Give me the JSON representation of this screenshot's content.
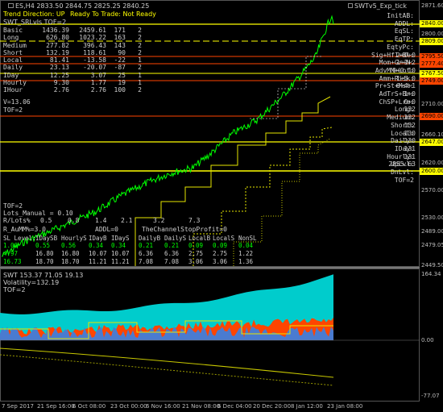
{
  "header": {
    "symbol_line": "ES,H4  2833.50 2844.75 2825.25 2840.25",
    "indicator_name": "SWTv5_Exp_tick"
  },
  "status": {
    "trend": "Trend Direction:  UP",
    "ready": "Ready To Trade:  Not Ready",
    "indicator": "SWT_SRLvls TOF=2"
  },
  "stats_table": [
    [
      "Basic",
      "1436.39",
      "2459.61",
      "171",
      "2"
    ],
    [
      "Long",
      "626.80",
      "1023.22",
      "163",
      "2"
    ],
    [
      "Medium",
      "277.82",
      "396.43",
      "143",
      "2"
    ],
    [
      "Short",
      "132.19",
      "118.61",
      "90",
      "2"
    ],
    [
      "Local",
      "81.41",
      "-13.58",
      "-22",
      "1"
    ],
    [
      "Daily",
      "23.13",
      "-20.07",
      "-87",
      "2"
    ],
    [
      "IDay",
      "12.25",
      "3.07",
      "25",
      "1"
    ],
    [
      "Hourly",
      "9.30",
      "1.77",
      "19",
      "1"
    ],
    [
      "IHour",
      "2.76",
      "2.76",
      "100",
      "2"
    ]
  ],
  "left_extra": [
    "V=13.06",
    "TOF=2"
  ],
  "right_panel": [
    [
      "InitAB:",
      ""
    ],
    [
      "ADDL:",
      ""
    ],
    [
      "EqSL:",
      ""
    ],
    [
      "EqTP:",
      ""
    ],
    [
      "EqtyPc:",
      ""
    ],
    [
      "Sig+Hf1+Bl:",
      "2+0+0"
    ],
    [
      "Mom+Gr+N:",
      "1+1+2"
    ],
    [
      "AdvMM+Lot:",
      "0+0.10"
    ],
    [
      "Amm+Risk:",
      "1+5.0"
    ],
    [
      "Pr+St+Mst:",
      "6+4+1"
    ],
    [
      "AdTrS+Br:",
      "1+0"
    ],
    [
      "ChSP+Lre:",
      "0+0"
    ],
    [
      "Long:",
      "132"
    ],
    [
      "Medium:",
      "132"
    ],
    [
      "Short:",
      "132"
    ],
    [
      "Local:",
      "-130"
    ],
    [
      "Daily:",
      "-130"
    ],
    [
      "IDay:",
      "131"
    ],
    [
      "Hourly:",
      "131"
    ],
    [
      "UpLvl:",
      "2855.63"
    ],
    [
      "DnLvl:",
      ""
    ],
    [
      "TOF=2",
      ""
    ]
  ],
  "lots": {
    "tof": "TOF=2",
    "manual": "Lots_Manual = 0.10",
    "rlots_label": "R/Lots%",
    "rlots_values": [
      "0.5",
      "0.8",
      "1.4",
      "2.1",
      "3.2",
      "7.3"
    ],
    "aumm": "R_AuMM%=3.0",
    "addl": "ADDL=0",
    "channel": "TheChannelStopProfit=0",
    "sl_headers": [
      "SL Level:",
      "IDaySB",
      "HourlyS",
      "IDayB",
      "IDayS",
      "DailyB",
      "DailyS",
      "LocalB",
      "LocalS",
      "NonSL"
    ],
    "sl_row1": [
      "1.00",
      "0.55",
      "0.56",
      "0.34",
      "0.34",
      "0.21",
      "0.21",
      "0.09",
      "0.09",
      "0.04"
    ],
    "sl_row2": [
      "4.97",
      "16.80",
      "16.80",
      "10.07",
      "10.07",
      "6.36",
      "6.36",
      "2.75",
      "2.75",
      "1.22"
    ],
    "sl_row3": [
      "16.73",
      "18.70",
      "18.70",
      "11.21",
      "11.21",
      "7.08",
      "7.08",
      "3.06",
      "3.06",
      "1.36"
    ]
  },
  "price_axis": {
    "labels": [
      "2871.60",
      "2800.00",
      "2710.00",
      "2660.10",
      "2620.00",
      "2570.00",
      "2530.00",
      "2489.00",
      "2479.05",
      "2449.50"
    ],
    "tags": [
      {
        "text": "2840.00",
        "color": "#ffff00"
      },
      {
        "text": "2809.00",
        "color": "#ffff00"
      },
      {
        "text": "2795.50",
        "color": "#ff4500"
      },
      {
        "text": "2777.40",
        "color": "#ff4500"
      },
      {
        "text": "2767.50",
        "color": "#ffff00"
      },
      {
        "text": "2749.00",
        "color": "#ff4500"
      },
      {
        "text": "2690.00",
        "color": "#ff4500"
      },
      {
        "text": "2647.00",
        "color": "#ffff00"
      },
      {
        "text": "2600.00",
        "color": "#ffff00"
      }
    ]
  },
  "sub_window": {
    "title": "SWT 153.37 71.05 19.13",
    "volatility": "Volatility=132.19",
    "tof": "TOF=2",
    "labels": [
      "164.34",
      "0.00",
      "-77.07"
    ]
  },
  "time_axis": [
    "7 Sep 2017",
    "21 Sep 16:00",
    "6 Oct 08:00",
    "23 Oct 00:00",
    "6 Nov 16:00",
    "21 Nov 08:00",
    "6 Dec 04:00",
    "20 Dec 20:00",
    "8 Jan 12:00",
    "23 Jan 08:00"
  ],
  "colors": {
    "price": "#00ff00",
    "level": "#ffff00",
    "resistance": "#ff4500",
    "cyan": "#00cccc",
    "orange": "#ff4500",
    "blue": "#4a7bd0"
  }
}
